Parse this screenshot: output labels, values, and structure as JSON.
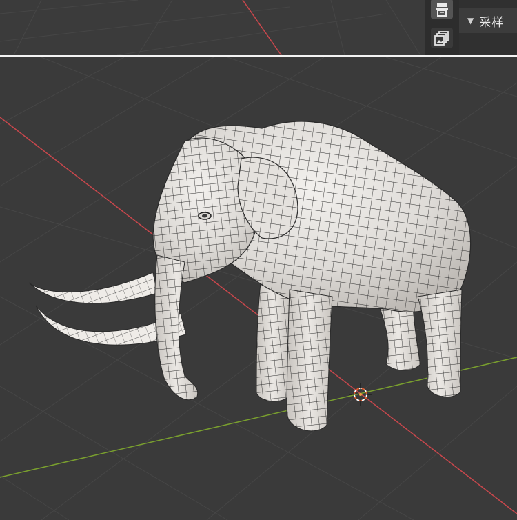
{
  "properties": {
    "section_title": "采样",
    "tabs": [
      {
        "name": "output",
        "icon": "output-printer-icon"
      },
      {
        "name": "view-layer",
        "icon": "view-layer-icon"
      }
    ]
  },
  "viewport": {
    "object": "elephant",
    "shading": "wireframe-overlay",
    "axis_colors": {
      "x": "#c8474c",
      "y": "#7aa02e"
    },
    "grid_color": "#444444",
    "background": "#3a3a3a",
    "cursor_color": "#e05a2a"
  }
}
